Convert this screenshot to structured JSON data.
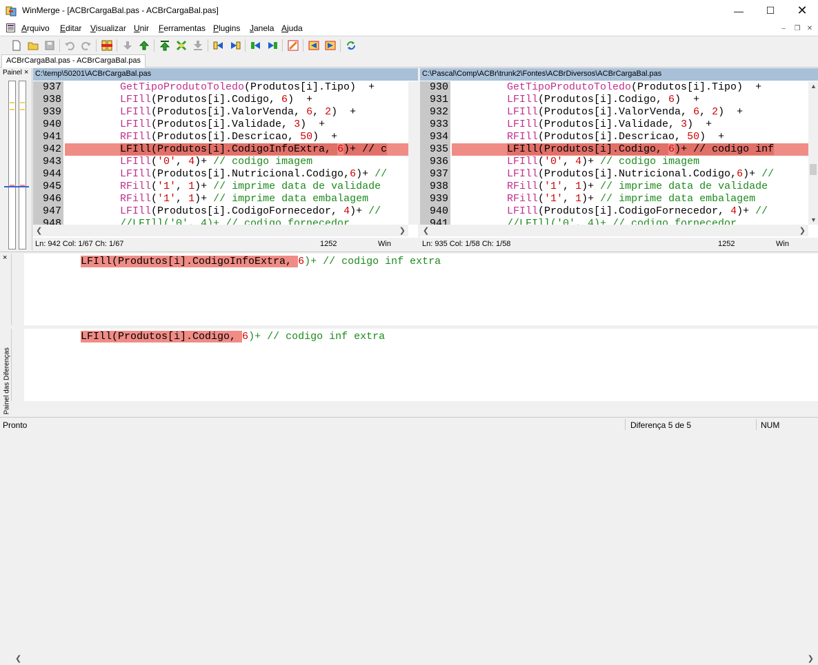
{
  "window": {
    "title": "WinMerge - [ACBrCargaBal.pas - ACBrCargaBal.pas]"
  },
  "menu": [
    "Arquivo",
    "Editar",
    "Visualizar",
    "Unir",
    "Ferramentas",
    "Plugins",
    "Janela",
    "Ajuda"
  ],
  "menu_underline": [
    "A",
    "E",
    "V",
    "U",
    "F",
    "P",
    "J",
    "A"
  ],
  "tab": {
    "label": "ACBrCargaBal.pas - ACBrCargaBal.pas"
  },
  "location_pane": {
    "label": "Painel",
    "close": "×"
  },
  "left": {
    "path": "C:\\temp\\50201\\ACBrCargaBal.pas",
    "lines": [
      {
        "n": "937",
        "code": [
          [
            "fn",
            "GetTipoProdutoToledo"
          ],
          [
            "kw",
            "(Produtos[i].Tipo)"
          ],
          [
            "kw",
            "  +"
          ]
        ]
      },
      {
        "n": "938",
        "code": [
          [
            "fn",
            "LFIll"
          ],
          [
            "kw",
            "(Produtos[i].Codigo, "
          ],
          [
            "num",
            "6"
          ],
          [
            "kw",
            ")  +"
          ]
        ]
      },
      {
        "n": "939",
        "code": [
          [
            "fn",
            "LFIll"
          ],
          [
            "kw",
            "(Produtos[i].ValorVenda, "
          ],
          [
            "num",
            "6"
          ],
          [
            "kw",
            ", "
          ],
          [
            "num",
            "2"
          ],
          [
            "kw",
            ")  +"
          ]
        ]
      },
      {
        "n": "940",
        "code": [
          [
            "fn",
            "LFIll"
          ],
          [
            "kw",
            "(Produtos[i].Validade, "
          ],
          [
            "num",
            "3"
          ],
          [
            "kw",
            ")  +"
          ]
        ]
      },
      {
        "n": "941",
        "code": [
          [
            "fn",
            "RFIll"
          ],
          [
            "kw",
            "(Produtos[i].Descricao, "
          ],
          [
            "num",
            "50"
          ],
          [
            "kw",
            ")  +"
          ]
        ]
      },
      {
        "n": "942",
        "diff": true,
        "code": [
          [
            "kw",
            "LFIll(Produtos[i].CodigoInfoExtra, "
          ],
          [
            "num",
            "6"
          ],
          [
            "kw",
            ")+ // c"
          ]
        ]
      },
      {
        "n": "943",
        "code": [
          [
            "fn",
            "LFIll"
          ],
          [
            "kw",
            "("
          ],
          [
            "str",
            "'0'"
          ],
          [
            "kw",
            ", "
          ],
          [
            "num",
            "4"
          ],
          [
            "kw",
            ")+ "
          ],
          [
            "cm",
            "// codigo imagem"
          ]
        ]
      },
      {
        "n": "944",
        "code": [
          [
            "fn",
            "LFIll"
          ],
          [
            "kw",
            "(Produtos[i].Nutricional.Codigo,"
          ],
          [
            "num",
            "6"
          ],
          [
            "kw",
            ")+ "
          ],
          [
            "cm",
            "//"
          ]
        ]
      },
      {
        "n": "945",
        "code": [
          [
            "fn",
            "RFill"
          ],
          [
            "kw",
            "("
          ],
          [
            "str",
            "'1'"
          ],
          [
            "kw",
            ", "
          ],
          [
            "num",
            "1"
          ],
          [
            "kw",
            ")+ "
          ],
          [
            "cm",
            "// imprime data de validade"
          ]
        ]
      },
      {
        "n": "946",
        "code": [
          [
            "fn",
            "RFill"
          ],
          [
            "kw",
            "("
          ],
          [
            "str",
            "'1'"
          ],
          [
            "kw",
            ", "
          ],
          [
            "num",
            "1"
          ],
          [
            "kw",
            ")+ "
          ],
          [
            "cm",
            "// imprime data embalagem"
          ]
        ]
      },
      {
        "n": "947",
        "code": [
          [
            "fn",
            "LFIll"
          ],
          [
            "kw",
            "(Produtos[i].CodigoFornecedor, "
          ],
          [
            "num",
            "4"
          ],
          [
            "kw",
            ")+ "
          ],
          [
            "cm",
            "//"
          ]
        ]
      },
      {
        "n": "948",
        "code": [
          [
            "cm",
            "//LFIll('0', 4)+ // codigo fornecedor"
          ]
        ]
      }
    ],
    "status": {
      "pos": "Ln: 942  Col: 1/67  Ch: 1/67",
      "codepage": "1252",
      "eol": "Win"
    }
  },
  "right": {
    "path": "C:\\Pascal\\Comp\\ACBr\\trunk2\\Fontes\\ACBrDiversos\\ACBrCargaBal.pas",
    "lines": [
      {
        "n": "930",
        "code": [
          [
            "fn",
            "GetTipoProdutoToledo"
          ],
          [
            "kw",
            "(Produtos[i].Tipo)"
          ],
          [
            "kw",
            "  +"
          ]
        ]
      },
      {
        "n": "931",
        "code": [
          [
            "fn",
            "LFIll"
          ],
          [
            "kw",
            "(Produtos[i].Codigo, "
          ],
          [
            "num",
            "6"
          ],
          [
            "kw",
            ")  +"
          ]
        ]
      },
      {
        "n": "932",
        "code": [
          [
            "fn",
            "LFIll"
          ],
          [
            "kw",
            "(Produtos[i].ValorVenda, "
          ],
          [
            "num",
            "6"
          ],
          [
            "kw",
            ", "
          ],
          [
            "num",
            "2"
          ],
          [
            "kw",
            ")  +"
          ]
        ]
      },
      {
        "n": "933",
        "code": [
          [
            "fn",
            "LFIll"
          ],
          [
            "kw",
            "(Produtos[i].Validade, "
          ],
          [
            "num",
            "3"
          ],
          [
            "kw",
            ")  +"
          ]
        ]
      },
      {
        "n": "934",
        "code": [
          [
            "fn",
            "RFIll"
          ],
          [
            "kw",
            "(Produtos[i].Descricao, "
          ],
          [
            "num",
            "50"
          ],
          [
            "kw",
            ")  +"
          ]
        ]
      },
      {
        "n": "935",
        "diff": true,
        "code": [
          [
            "kw",
            "LFIll(Produtos[i].Codigo, "
          ],
          [
            "num",
            "6"
          ],
          [
            "kw",
            ")+ // codigo inf"
          ]
        ]
      },
      {
        "n": "936",
        "code": [
          [
            "fn",
            "LFIll"
          ],
          [
            "kw",
            "("
          ],
          [
            "str",
            "'0'"
          ],
          [
            "kw",
            ", "
          ],
          [
            "num",
            "4"
          ],
          [
            "kw",
            ")+ "
          ],
          [
            "cm",
            "// codigo imagem"
          ]
        ]
      },
      {
        "n": "937",
        "code": [
          [
            "fn",
            "LFIll"
          ],
          [
            "kw",
            "(Produtos[i].Nutricional.Codigo,"
          ],
          [
            "num",
            "6"
          ],
          [
            "kw",
            ")+ "
          ],
          [
            "cm",
            "//"
          ]
        ]
      },
      {
        "n": "938",
        "code": [
          [
            "fn",
            "RFill"
          ],
          [
            "kw",
            "("
          ],
          [
            "str",
            "'1'"
          ],
          [
            "kw",
            ", "
          ],
          [
            "num",
            "1"
          ],
          [
            "kw",
            ")+ "
          ],
          [
            "cm",
            "// imprime data de validade"
          ]
        ]
      },
      {
        "n": "939",
        "code": [
          [
            "fn",
            "RFill"
          ],
          [
            "kw",
            "("
          ],
          [
            "str",
            "'1'"
          ],
          [
            "kw",
            ", "
          ],
          [
            "num",
            "1"
          ],
          [
            "kw",
            ")+ "
          ],
          [
            "cm",
            "// imprime data embalagem"
          ]
        ]
      },
      {
        "n": "940",
        "code": [
          [
            "fn",
            "LFIll"
          ],
          [
            "kw",
            "(Produtos[i].CodigoFornecedor, "
          ],
          [
            "num",
            "4"
          ],
          [
            "kw",
            ")+ "
          ],
          [
            "cm",
            "//"
          ]
        ]
      },
      {
        "n": "941",
        "code": [
          [
            "cm",
            "//LFIll('0', 4)+ // codigo fornecedor"
          ]
        ]
      }
    ],
    "status": {
      "pos": "Ln: 935  Col: 1/58  Ch: 1/58",
      "codepage": "1252",
      "eol": "Win"
    }
  },
  "diff_pane": {
    "title": "Painel das Diferenças",
    "close": "×",
    "top": {
      "hl": "LFIll(Produtos[i].CodigoInfoExtra, ",
      "rest_num": "6",
      "rest": ")+ // codigo inf extra"
    },
    "bottom": {
      "hl": "LFIll(Produtos[i].Codigo, ",
      "rest_num": "6",
      "rest": ")+ // codigo inf extra"
    }
  },
  "statusbar": {
    "left": "Pronto",
    "diff": "Diferença 5 de 5",
    "num": "NUM"
  },
  "colors": {
    "diff_bg": "#f08c86",
    "diff_hl": "#e07068",
    "header_bg": "#a8c0d8",
    "gutter": "#c8c8c8"
  }
}
